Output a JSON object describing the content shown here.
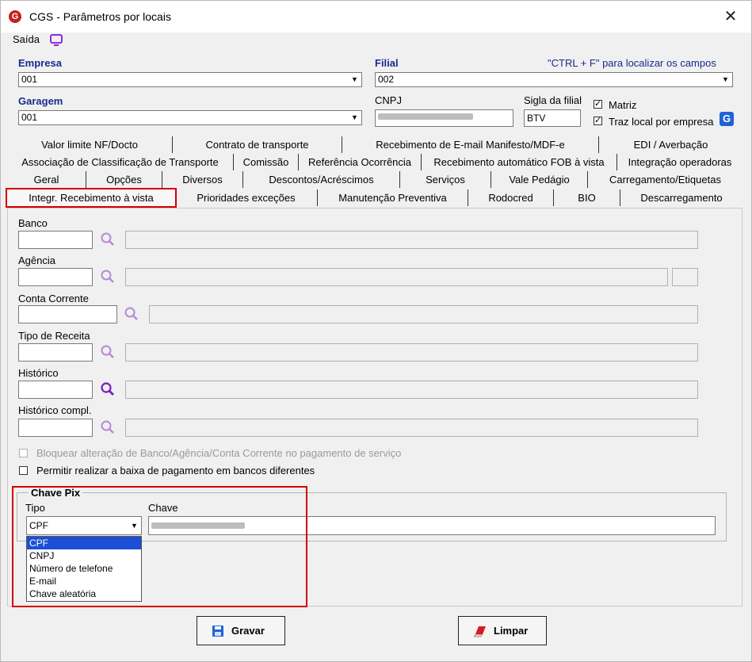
{
  "window": {
    "title": "CGS - Parâmetros por locais",
    "close": "✕"
  },
  "menu": {
    "saida": "Saída"
  },
  "empresa": {
    "label": "Empresa",
    "value": "001"
  },
  "filial": {
    "label": "Filial",
    "value": "002",
    "hint": "\"CTRL + F\" para localizar os campos"
  },
  "garagem": {
    "label": "Garagem",
    "value": "001"
  },
  "cnpj": {
    "label": "CNPJ",
    "value": ""
  },
  "sigla": {
    "label": "Sigla da filial",
    "value": "BTV"
  },
  "matriz": {
    "label": "Matriz",
    "checked": true
  },
  "traz_local": {
    "label": "Traz local por empresa",
    "checked": true
  },
  "tabs": {
    "row1": [
      "Valor limite NF/Docto",
      "Contrato de transporte",
      "Recebimento de E-mail Manifesto/MDF-e",
      "EDI / Averbação"
    ],
    "row2": [
      "Associação de Classificação de Transporte",
      "Comissão",
      "Referência Ocorrência",
      "Recebimento automático FOB à vista",
      "Integração operadoras"
    ],
    "row3": [
      "Geral",
      "Opções",
      "Diversos",
      "Descontos/Acréscimos",
      "Serviços",
      "Vale Pedágio",
      "Carregamento/Etiquetas"
    ],
    "row4": [
      "Integr. Recebimento à vista",
      "Prioridades exceções",
      "Manutenção Preventiva",
      "Rodocred",
      "BIO",
      "Descarregamento"
    ],
    "active": "Integr. Recebimento à vista"
  },
  "fields": {
    "banco": "Banco",
    "agencia": "Agência",
    "conta": "Conta Corrente",
    "tipo_receita": "Tipo de Receita",
    "historico": "Histórico",
    "historico_compl": "Histórico compl."
  },
  "checks": {
    "bloquear": "Bloquear alteração de Banco/Agência/Conta Corrente no pagamento de serviço",
    "permitir": "Permitir realizar a baixa de pagamento em bancos diferentes"
  },
  "pix": {
    "group": "Chave Pix",
    "tipo_label": "Tipo",
    "chave_label": "Chave",
    "tipo_value": "CPF",
    "options": [
      "CPF",
      "CNPJ",
      "Número de telefone",
      "E-mail",
      "Chave aleatória"
    ]
  },
  "buttons": {
    "gravar": "Gravar",
    "limpar": "Limpar"
  },
  "colors": {
    "accent": "#1a2a8c",
    "highlight": "#d20000",
    "selection": "#1a4fd6",
    "icon": "#8a2be2"
  }
}
